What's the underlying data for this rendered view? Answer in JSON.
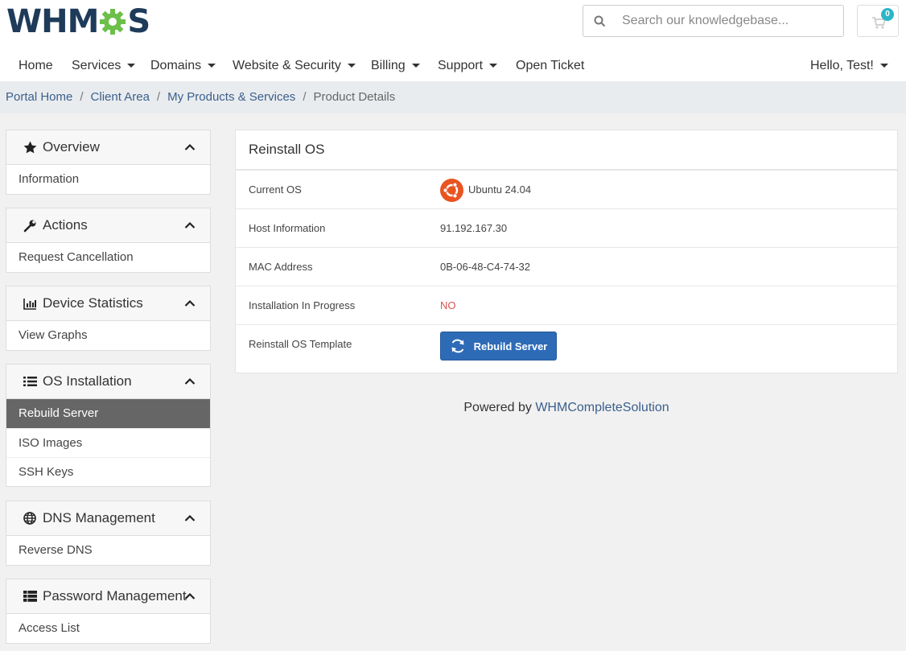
{
  "brand": {
    "logo_left": "WHM",
    "logo_right": "S",
    "accent": "#1f3b5a",
    "gear_color": "#6cc04a"
  },
  "search": {
    "placeholder": "Search our knowledgebase..."
  },
  "cart": {
    "count": "0"
  },
  "nav": {
    "home": "Home",
    "services": "Services",
    "domains": "Domains",
    "website_security": "Website & Security",
    "billing": "Billing",
    "support": "Support",
    "open_ticket": "Open Ticket",
    "user": "Hello, Test!"
  },
  "breadcrumb": {
    "items": [
      "Portal Home",
      "Client Area",
      "My Products & Services"
    ],
    "active": "Product Details",
    "sep": "/"
  },
  "sidebar": {
    "overview": {
      "title": "Overview",
      "icon": "star-icon",
      "items": [
        "Information"
      ]
    },
    "actions": {
      "title": "Actions",
      "icon": "wrench-icon",
      "items": [
        "Request Cancellation"
      ]
    },
    "device_statistics": {
      "title": "Device Statistics",
      "icon": "chart-icon",
      "items": [
        "View Graphs"
      ]
    },
    "os_installation": {
      "title": "OS Installation",
      "icon": "list-icon",
      "items": [
        "Rebuild Server",
        "ISO Images",
        "SSH Keys"
      ],
      "active_index": 0
    },
    "dns_management": {
      "title": "DNS Management",
      "icon": "globe-icon",
      "items": [
        "Reverse DNS"
      ]
    },
    "password_management": {
      "title": "Password Management",
      "icon": "table-icon",
      "items": [
        "Access List"
      ]
    }
  },
  "card": {
    "title": "Reinstall OS",
    "rows": [
      {
        "label": "Current OS",
        "value": "Ubuntu 24.04"
      },
      {
        "label": "Host Information",
        "value": "91.192.167.30"
      },
      {
        "label": "MAC Address",
        "value": "0B-06-48-C4-74-32"
      },
      {
        "label": "Installation In Progress",
        "value": "NO"
      },
      {
        "label": "Reinstall OS Template",
        "value": ""
      }
    ],
    "button_label": "Rebuild Server"
  },
  "footer": {
    "prefix": "Powered by",
    "link": "WHMCompleteSolution"
  }
}
